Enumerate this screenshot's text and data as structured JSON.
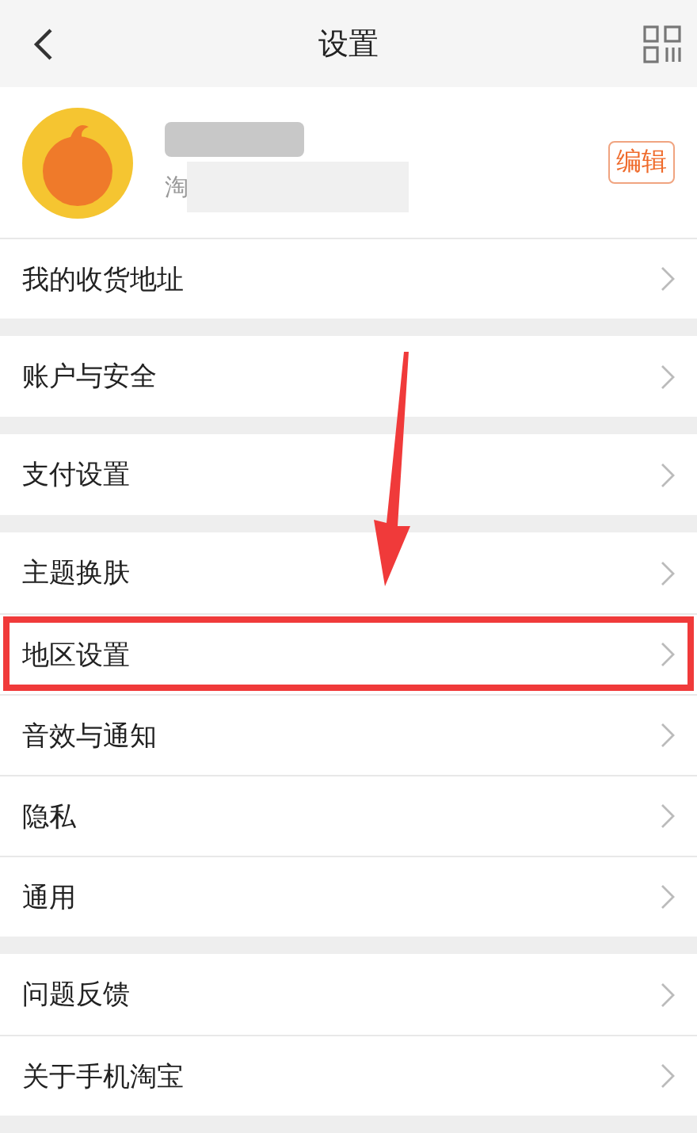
{
  "header": {
    "title": "设置"
  },
  "profile": {
    "subtitle": "淘",
    "edit_button": "编辑"
  },
  "groups": [
    {
      "items": [
        {
          "label": "我的收货地址",
          "highlighted": false
        }
      ]
    },
    {
      "items": [
        {
          "label": "账户与安全",
          "highlighted": false
        }
      ]
    },
    {
      "items": [
        {
          "label": "支付设置",
          "highlighted": false
        }
      ]
    },
    {
      "items": [
        {
          "label": "主题换肤",
          "highlighted": false
        },
        {
          "label": "地区设置",
          "highlighted": true
        },
        {
          "label": "音效与通知",
          "highlighted": false
        },
        {
          "label": "隐私",
          "highlighted": false
        },
        {
          "label": "通用",
          "highlighted": false
        }
      ]
    },
    {
      "items": [
        {
          "label": "问题反馈",
          "highlighted": false
        },
        {
          "label": "关于手机淘宝",
          "highlighted": false
        }
      ]
    }
  ]
}
